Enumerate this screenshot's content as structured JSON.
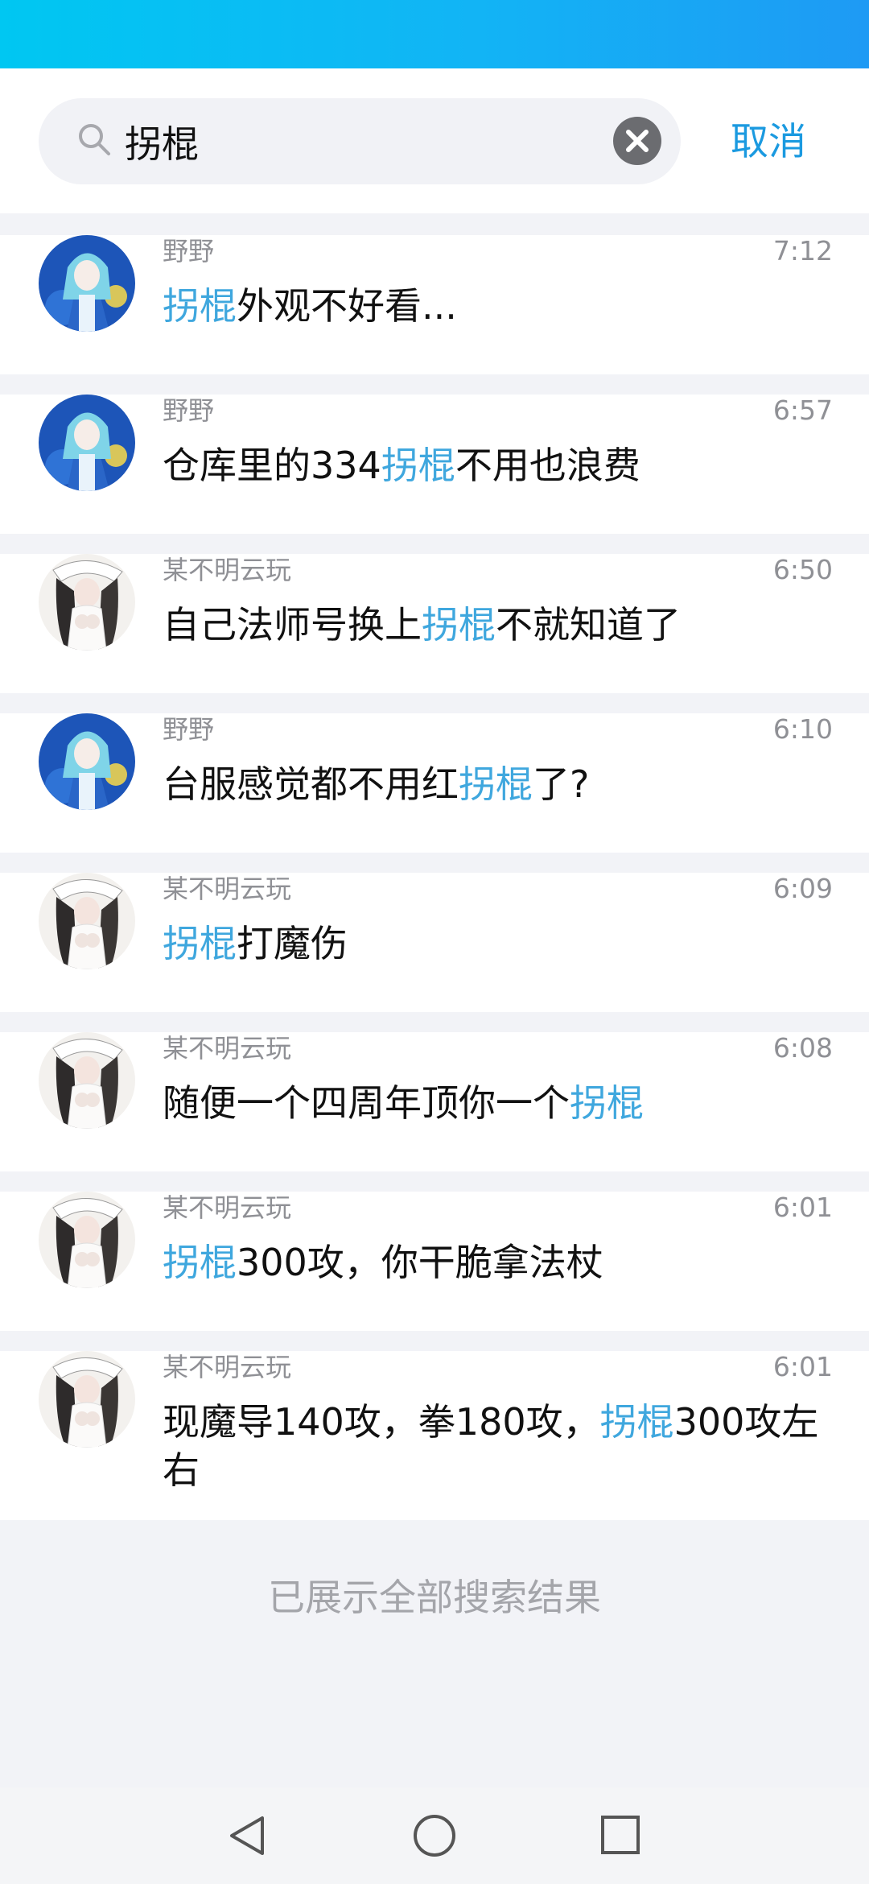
{
  "search": {
    "query": "拐棍",
    "cancel_label": "取消"
  },
  "results": [
    {
      "sender": "野野",
      "time": "7:12",
      "avatar": "blue-character-avatar",
      "message": [
        {
          "t": "拐棍",
          "hl": true
        },
        {
          "t": "外观不好看...",
          "hl": false
        }
      ]
    },
    {
      "sender": "野野",
      "time": "6:57",
      "avatar": "blue-character-avatar",
      "message": [
        {
          "t": "仓库里的334",
          "hl": false
        },
        {
          "t": "拐棍",
          "hl": true
        },
        {
          "t": "不用也浪费",
          "hl": false
        }
      ]
    },
    {
      "sender": "某不明云玩",
      "time": "6:50",
      "avatar": "white-dress-character-avatar",
      "message": [
        {
          "t": "自己法师号换上",
          "hl": false
        },
        {
          "t": "拐棍",
          "hl": true
        },
        {
          "t": "不就知道了",
          "hl": false
        }
      ]
    },
    {
      "sender": "野野",
      "time": "6:10",
      "avatar": "blue-character-avatar",
      "message": [
        {
          "t": "台服感觉都不用红",
          "hl": false
        },
        {
          "t": "拐棍",
          "hl": true
        },
        {
          "t": "了?",
          "hl": false
        }
      ]
    },
    {
      "sender": "某不明云玩",
      "time": "6:09",
      "avatar": "white-dress-character-avatar",
      "message": [
        {
          "t": "拐棍",
          "hl": true
        },
        {
          "t": "打魔伤",
          "hl": false
        }
      ]
    },
    {
      "sender": "某不明云玩",
      "time": "6:08",
      "avatar": "white-dress-character-avatar",
      "message": [
        {
          "t": "随便一个四周年顶你一个",
          "hl": false
        },
        {
          "t": "拐棍",
          "hl": true
        }
      ]
    },
    {
      "sender": "某不明云玩",
      "time": "6:01",
      "avatar": "white-dress-character-avatar",
      "message": [
        {
          "t": "拐棍",
          "hl": true
        },
        {
          "t": "300攻，你干脆拿法杖",
          "hl": false
        }
      ]
    },
    {
      "sender": "某不明云玩",
      "time": "6:01",
      "avatar": "white-dress-character-avatar",
      "message": [
        {
          "t": "现魔导140攻，拳180攻，",
          "hl": false
        },
        {
          "t": "拐棍",
          "hl": true
        },
        {
          "t": "300攻左右",
          "hl": false
        }
      ]
    }
  ],
  "end_text": "已展示全部搜索结果",
  "nav": {
    "back_icon": "triangle-back-icon",
    "home_icon": "circle-home-icon",
    "recents_icon": "square-recents-icon"
  },
  "colors": {
    "accent": "#1b9ae0",
    "highlight": "#3fa7de",
    "status_bar_start": "#00c7f2",
    "status_bar_end": "#1e9af4"
  }
}
